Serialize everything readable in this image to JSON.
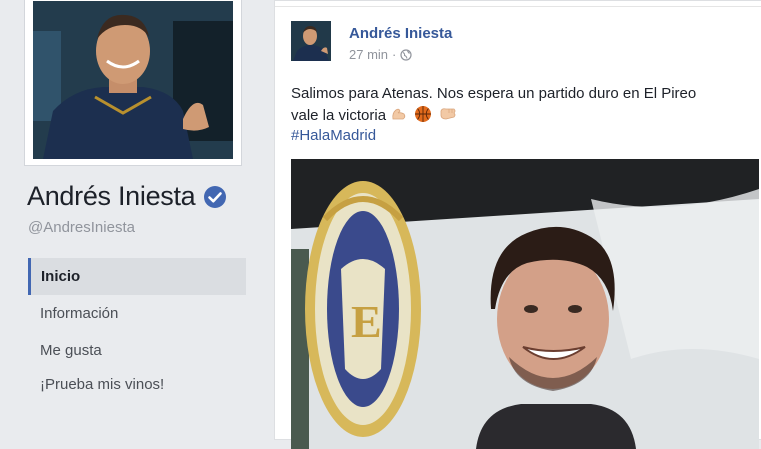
{
  "profile": {
    "name": "Andrés Iniesta",
    "handle": "@AndresIniesta",
    "verified": true,
    "verified_color": "#4267b2"
  },
  "nav": {
    "items": [
      {
        "label": "Inicio",
        "active": true
      },
      {
        "label": "Información",
        "active": false
      },
      {
        "label": "Me gusta",
        "active": false
      },
      {
        "label": "¡Prueba mis vinos!",
        "active": false
      }
    ]
  },
  "post": {
    "author": "Andrés Iniesta",
    "time": "27 min",
    "separator": "·",
    "privacy_icon": "globe-icon",
    "text_line1": "Salimos para Atenas. Nos espera un partido duro en El Pireo",
    "text_line2": "vale la victoria",
    "emojis": [
      "flexed-biceps-icon",
      "basketball-icon",
      "fist-bump-icon"
    ],
    "hashtag": "#HalaMadrid"
  },
  "colors": {
    "link": "#365899",
    "page_bg": "#e9ebee",
    "active_nav_border": "#4267b2"
  }
}
